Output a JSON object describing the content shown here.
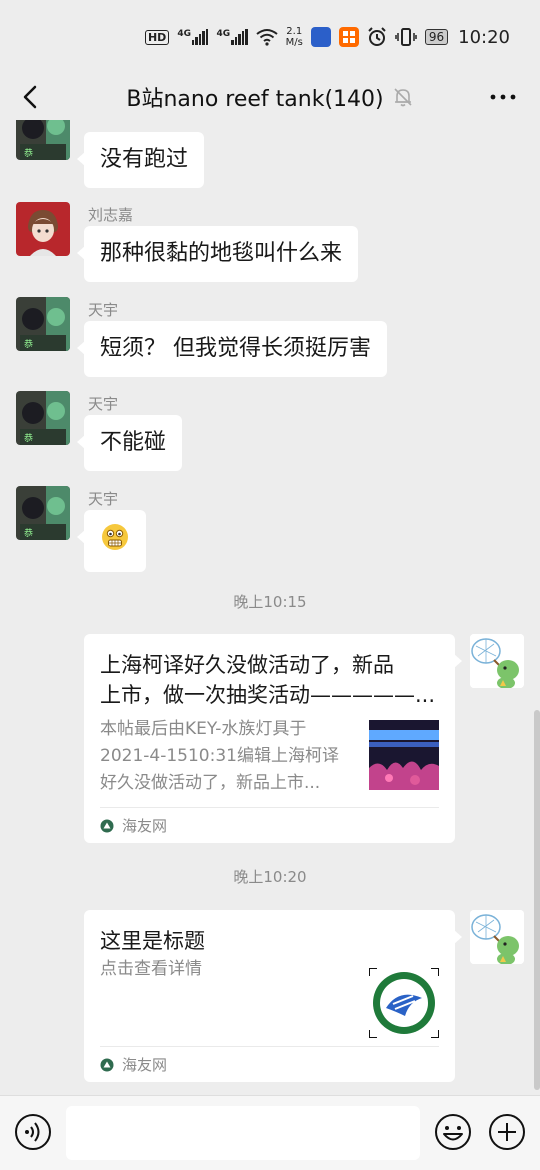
{
  "status_bar": {
    "hd": "HD",
    "net1": "4G",
    "net2": "4G",
    "speed_value": "2.1",
    "speed_unit": "M/s",
    "battery": "96",
    "time": "10:20"
  },
  "header": {
    "title": "B站nano reef tank(140)"
  },
  "messages": [
    {
      "sender": "",
      "text": "没有跑过"
    },
    {
      "sender": "刘志嘉",
      "text": "那种很黏的地毯叫什么来"
    },
    {
      "sender": "天宇",
      "text": "短须？ 但我觉得长须挺厉害"
    },
    {
      "sender": "天宇",
      "text": "不能碰"
    },
    {
      "sender": "天宇",
      "text": "😬"
    }
  ],
  "timestamps": [
    "晚上10:15",
    "晚上10:20"
  ],
  "cards": [
    {
      "title_line1": "上海柯译好久没做活动了，新品",
      "title_line2": "上市，做一次抽奖活动—————...",
      "desc_line1": "本帖最后由KEY-水族灯具于",
      "desc_line2": "2021-4-1510:31编辑上海柯译",
      "desc_line3": "好久没做活动了，新品上市...",
      "source": "海友网"
    },
    {
      "title_line1": "这里是标题",
      "title_line2": "",
      "desc_line1": "点击查看详情",
      "desc_line2": "",
      "desc_line3": "",
      "source": "海友网"
    }
  ],
  "colors": {
    "background": "#ededed",
    "bubble": "#ffffff",
    "secondary_text": "#8a8a8a"
  },
  "icons": [
    "back-icon",
    "mute-bell-icon",
    "more-icon",
    "voice-icon",
    "emoji-icon",
    "plus-icon"
  ]
}
